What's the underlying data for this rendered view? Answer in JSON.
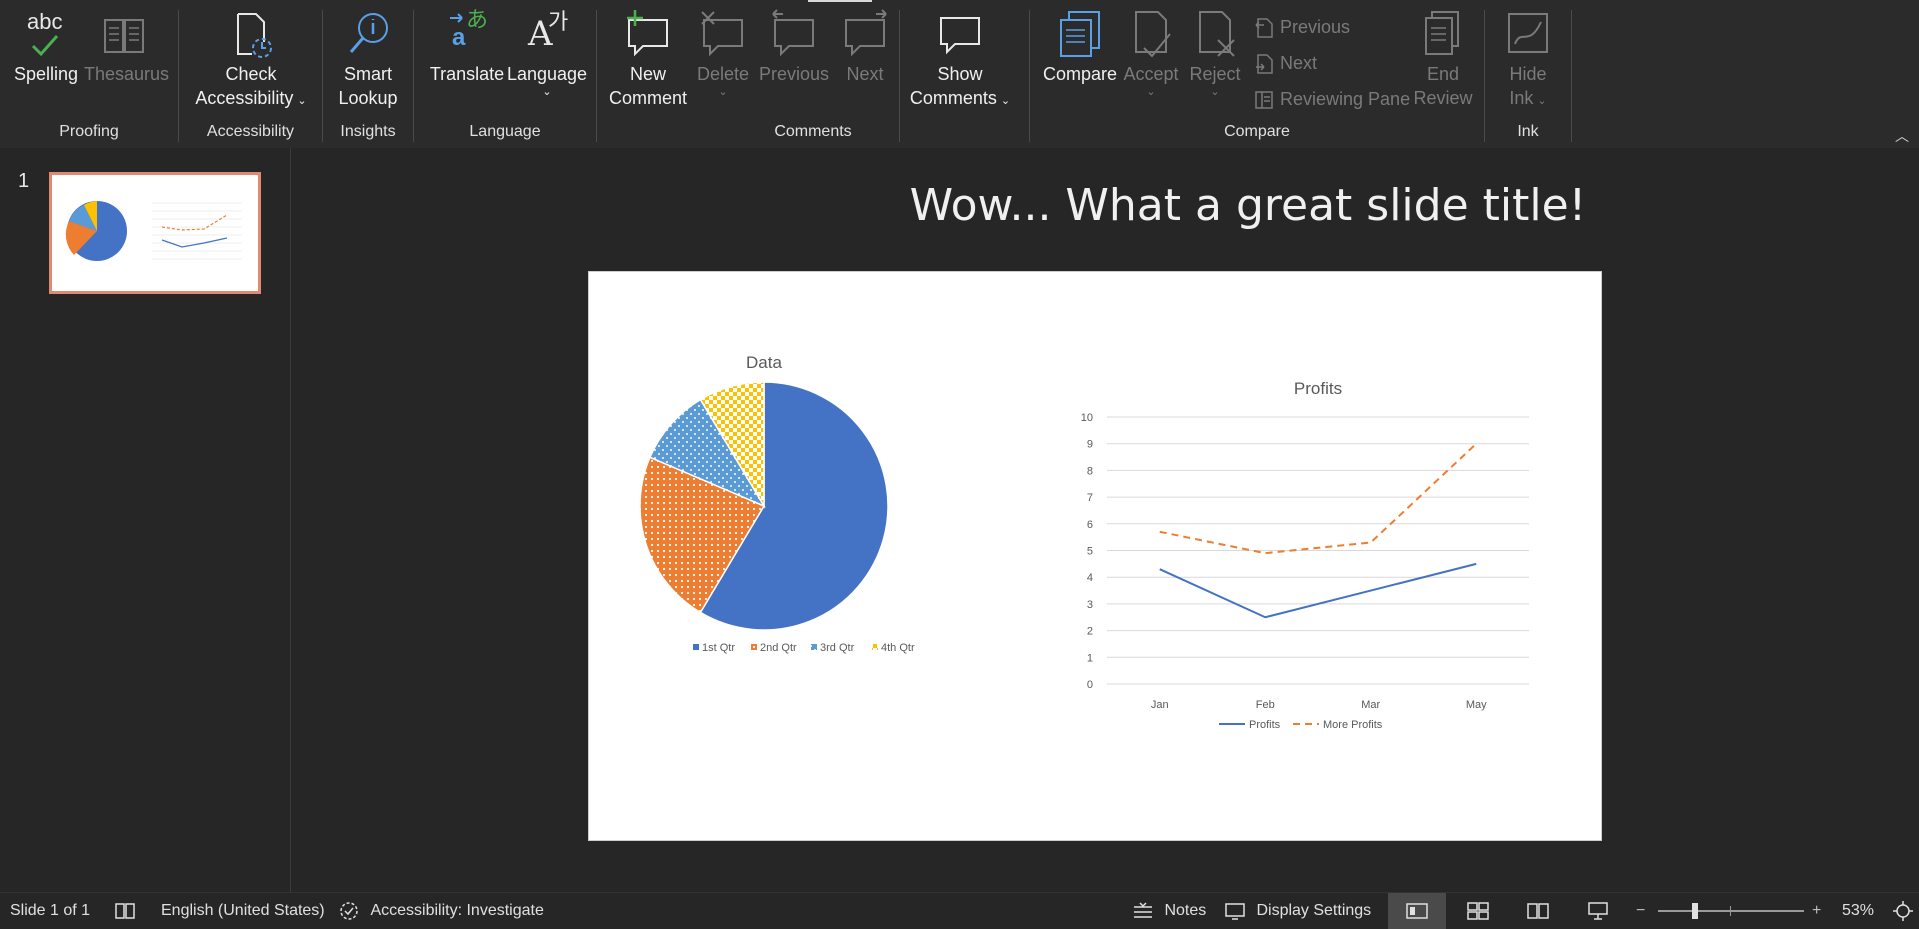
{
  "ribbon": {
    "groups": {
      "proofing": "Proofing",
      "accessibility": "Accessibility",
      "insights": "Insights",
      "language": "Language",
      "comments": "Comments",
      "compare": "Compare",
      "ink": "Ink"
    },
    "buttons": {
      "spelling": "Spelling",
      "thesaurus": "Thesaurus",
      "check_accessibility_1": "Check",
      "check_accessibility_2": "Accessibility",
      "smart_lookup_1": "Smart",
      "smart_lookup_2": "Lookup",
      "translate": "Translate",
      "language": "Language",
      "new_comment_1": "New",
      "new_comment_2": "Comment",
      "delete": "Delete",
      "previous": "Previous",
      "next": "Next",
      "show_comments_1": "Show",
      "show_comments_2": "Comments",
      "compare": "Compare",
      "accept": "Accept",
      "reject": "Reject",
      "compare_previous": "Previous",
      "compare_next": "Next",
      "reviewing_pane": "Reviewing Pane",
      "end_review_1": "End",
      "end_review_2": "Review",
      "hide_ink_1": "Hide",
      "hide_ink_2": "Ink"
    },
    "spelling_icon_text": "abc",
    "translate_icon_text": "あ",
    "language_icon_text": "가"
  },
  "thumbnails": [
    {
      "number": "1"
    }
  ],
  "slide": {
    "title": "Wow...  What a great slide title!"
  },
  "chart_data": [
    {
      "type": "pie",
      "title": "Data",
      "categories": [
        "1st Qtr",
        "2nd Qtr",
        "3rd Qtr",
        "4th Qtr"
      ],
      "values": [
        8.2,
        3.2,
        1.4,
        1.2
      ],
      "colors": [
        "#4472c4",
        "#ed7d31",
        "#5b9bd5",
        "#ffc000"
      ],
      "legend_position": "bottom"
    },
    {
      "type": "line",
      "title": "Profits",
      "categories": [
        "Jan",
        "Feb",
        "Mar",
        "May"
      ],
      "series": [
        {
          "name": "Profits",
          "values": [
            4.3,
            2.5,
            3.5,
            4.5
          ],
          "color": "#4472c4",
          "dash": "solid"
        },
        {
          "name": "More Profits",
          "values": [
            5.7,
            4.9,
            5.3,
            9.0
          ],
          "color": "#ed7d31",
          "dash": "dashed"
        }
      ],
      "ylim": [
        0,
        10
      ],
      "yticks": [
        "0",
        "1",
        "2",
        "3",
        "4",
        "5",
        "6",
        "7",
        "8",
        "9",
        "10"
      ],
      "grid": true,
      "legend_position": "bottom"
    }
  ],
  "status": {
    "slide_counter": "Slide 1 of 1",
    "language": "English (United States)",
    "accessibility": "Accessibility: Investigate",
    "notes": "Notes",
    "display_settings": "Display Settings",
    "zoom": "53%",
    "zoom_minus": "−",
    "zoom_plus": "+"
  }
}
